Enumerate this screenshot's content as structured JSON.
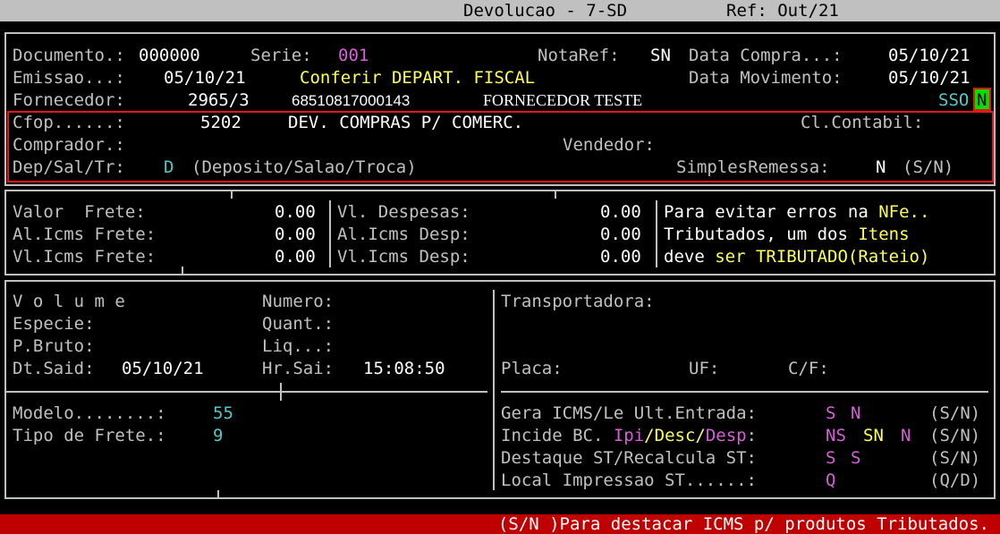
{
  "titlebar": {
    "title": "Devolucao - 7-SD",
    "ref": "Ref: Out/21"
  },
  "header": {
    "documento_label": "Documento.:",
    "documento_value": "000000",
    "serie_label": "Serie:",
    "serie_value": "001",
    "notaref_label": "NotaRef:",
    "notaref_value": "SN",
    "data_compra_label": "Data Compra...:",
    "data_compra_value": "05/10/21",
    "emissao_label": "Emissao...:",
    "emissao_value": "05/10/21",
    "conferir_text": "Conferir DEPART. FISCAL",
    "data_mov_label": "Data Movimento:",
    "data_mov_value": "05/10/21",
    "fornecedor_label": "Fornecedor:",
    "fornecedor_code": "2965/3",
    "fornecedor_cnpj": "68510817000143",
    "fornecedor_nome": "FORNECEDOR TESTE",
    "sso_text": "SSO",
    "sso_cursor": "N",
    "cfop_label": "Cfop......:",
    "cfop_value": "5202",
    "cfop_desc": "DEV. COMPRAS P/ COMERC.",
    "cl_contabil_label": "Cl.Contabil:",
    "comprador_label": "Comprador.:",
    "vendedor_label": "Vendedor:",
    "dep_label": "Dep/Sal/Tr:",
    "dep_value": "D",
    "dep_desc": "(Deposito/Salao/Troca)",
    "simples_label": "SimplesRemessa:",
    "simples_value": "N",
    "simples_opts": "(S/N)"
  },
  "frete": {
    "valor_frete_label": "Valor  Frete:",
    "valor_frete_value": "0.00",
    "al_icms_frete_label": "Al.Icms Frete:",
    "al_icms_frete_value": "0.00",
    "vl_icms_frete_label": "Vl.Icms Frete:",
    "vl_icms_frete_value": "0.00",
    "vl_despesas_label": "Vl. Despesas:",
    "vl_despesas_value": "0.00",
    "al_icms_desp_label": "Al.Icms Desp:",
    "al_icms_desp_value": "0.00",
    "vl_icms_desp_label": "Vl.Icms Desp:",
    "vl_icms_desp_value": "0.00",
    "msg1_a": "Para evitar erros na ",
    "msg1_b": "NFe..",
    "msg2_a": "Tributados, um dos ",
    "msg2_b": "Itens",
    "msg3_a": "deve ",
    "msg3_b": "ser TRIBUTADO(Rateio)"
  },
  "volume": {
    "volume_label": "V o l u m e",
    "numero_label": "Numero:",
    "especie_label": "Especie:",
    "quant_label": "Quant.:",
    "pbruto_label": "P.Bruto:",
    "liq_label": "Liq...:",
    "dtsaid_label": "Dt.Said:",
    "dtsaid_value": "05/10/21",
    "hrsai_label": "Hr.Sai:",
    "hrsai_value": "15:08:50"
  },
  "transport": {
    "transportadora_label": "Transportadora:",
    "placa_label": "Placa:",
    "uf_label": "UF:",
    "cf_label": "C/F:"
  },
  "modelo": {
    "modelo_label": "Modelo........:",
    "modelo_value": "55",
    "tipo_frete_label": "Tipo de Frete.:",
    "tipo_frete_value": "9"
  },
  "icms": {
    "gera_label": "Gera ICMS/Le Ult.Entrada:",
    "gera_v1": "S",
    "gera_v2": "N",
    "gera_opts": "(S/N)",
    "incide_a": "Incide BC. ",
    "incide_ipi": "Ipi",
    "incide_slash1": "/",
    "incide_desc": "Desc",
    "incide_slash2": "/",
    "incide_desp": "Desp",
    "incide_colon": ":",
    "incide_v1": "NS",
    "incide_v2": "SN",
    "incide_v3": "N",
    "incide_opts": "(S/N)",
    "destaque_label": "Destaque ST/Recalcula ST:",
    "destaque_v1": "S",
    "destaque_v2": "S",
    "destaque_opts": "(S/N)",
    "local_label": "Local Impressao ST......:",
    "local_value": "Q",
    "local_opts": "(Q/D)"
  },
  "statusbar": {
    "message": "(S/N )Para destacar ICMS p/ produtos Tributados."
  },
  "colors": {
    "yellow": "#ffff54",
    "magenta": "#d75fd7",
    "cyan": "#54c8c8",
    "highlight_red": "#e01818",
    "status_bg": "#c00000"
  }
}
